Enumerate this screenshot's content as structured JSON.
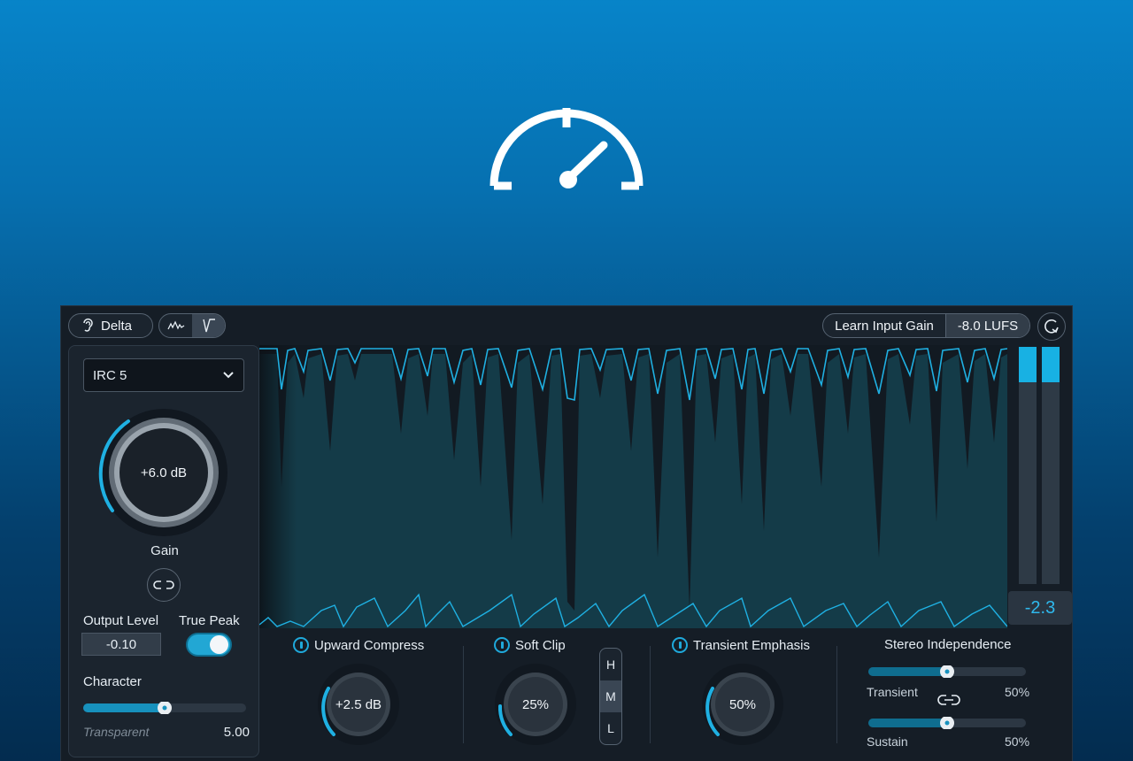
{
  "hero": {
    "icon": "speedometer-icon"
  },
  "toolbar": {
    "delta_label": "Delta",
    "learn_input_gain_label": "Learn Input Gain",
    "lufs_value": "-8.0 LUFS"
  },
  "left_panel": {
    "mode_select": "IRC 5",
    "gain_value": "+6.0 dB",
    "gain_label": "Gain",
    "output_level_label": "Output Level",
    "output_level_value": "-0.10",
    "true_peak_label": "True Peak",
    "true_peak_on": true,
    "character_label": "Character",
    "character_min_label": "Transparent",
    "character_value": "5.00",
    "character_fraction": 0.5
  },
  "meter": {
    "readout": "-2.3"
  },
  "modules": {
    "upward_compress": {
      "label": "Upward Compress",
      "value": "+2.5 dB"
    },
    "soft_clip": {
      "label": "Soft Clip",
      "value": "25%",
      "bands": [
        "H",
        "M",
        "L"
      ],
      "selected_band": "M"
    },
    "transient_emphasis": {
      "label": "Transient Emphasis",
      "value": "50%"
    },
    "stereo_independence": {
      "label": "Stereo Independence",
      "transient_label": "Transient",
      "transient_value": "50%",
      "sustain_label": "Sustain",
      "sustain_value": "50%"
    }
  },
  "colors": {
    "accent": "#1fb0e2",
    "panel": "#1b242e",
    "background": "#151d26"
  }
}
